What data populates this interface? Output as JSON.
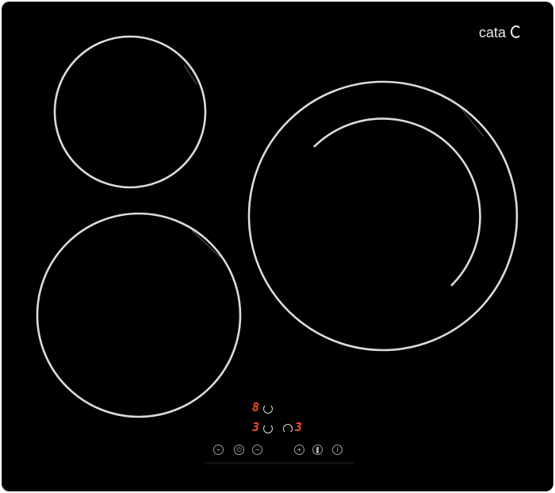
{
  "brand": {
    "name": "cata"
  },
  "displays": {
    "top_digit": "8",
    "left_digit": "3",
    "right_digit": "3"
  },
  "icons": {
    "timer_top": "timer-icon",
    "timer_left": "timer-icon",
    "timer_right": "timer-icon",
    "keys": [
      "lock-icon",
      "power-icon",
      "minus-icon",
      "plus-icon",
      "pause-icon",
      "info-icon"
    ]
  },
  "colors": {
    "surface": "#000000",
    "ring": "#dcdcdc",
    "display_red": "#ff4a2a",
    "brand_text": "#e9e9e9"
  }
}
